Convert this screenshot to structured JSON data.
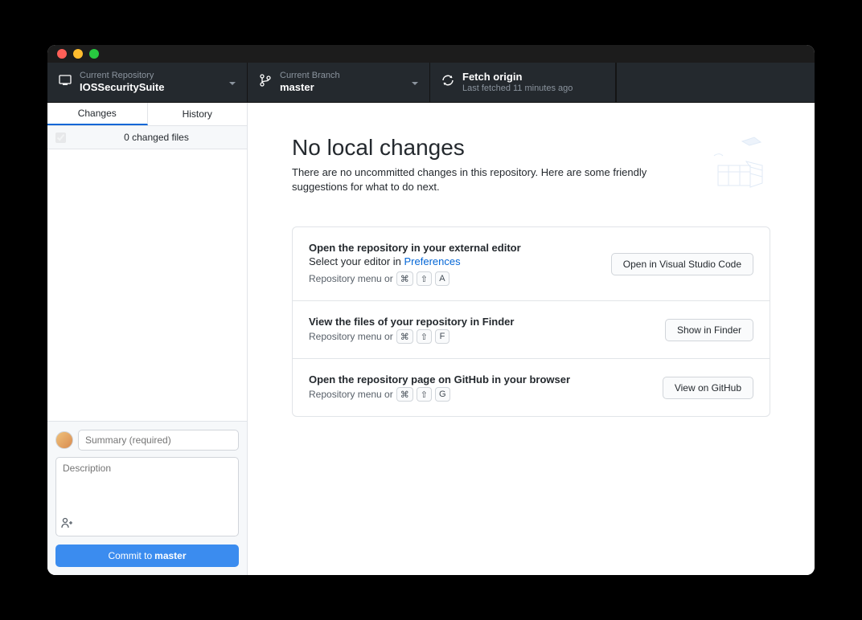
{
  "toolbar": {
    "repo": {
      "label": "Current Repository",
      "value": "IOSSecuritySuite"
    },
    "branch": {
      "label": "Current Branch",
      "value": "master"
    },
    "fetch": {
      "label": "Fetch origin",
      "value": "Last fetched 11 minutes ago"
    }
  },
  "tabs": {
    "changes": "Changes",
    "history": "History"
  },
  "changes_count_text": "0 changed files",
  "commit": {
    "summary_placeholder": "Summary (required)",
    "description_placeholder": "Description",
    "button_prefix": "Commit to ",
    "button_branch": "master"
  },
  "hero": {
    "title": "No local changes",
    "subtitle": "There are no uncommitted changes in this repository. Here are some friendly suggestions for what to do next."
  },
  "cards": [
    {
      "title": "Open the repository in your external editor",
      "sub_prefix": "Select your editor in ",
      "sub_link": "Preferences",
      "shortcut_prefix": "Repository menu or",
      "keys": [
        "⌘",
        "⇧",
        "A"
      ],
      "button": "Open in Visual Studio Code"
    },
    {
      "title": "View the files of your repository in Finder",
      "sub_prefix": "",
      "sub_link": "",
      "shortcut_prefix": "Repository menu or",
      "keys": [
        "⌘",
        "⇧",
        "F"
      ],
      "button": "Show in Finder"
    },
    {
      "title": "Open the repository page on GitHub in your browser",
      "sub_prefix": "",
      "sub_link": "",
      "shortcut_prefix": "Repository menu or",
      "keys": [
        "⌘",
        "⇧",
        "G"
      ],
      "button": "View on GitHub"
    }
  ]
}
